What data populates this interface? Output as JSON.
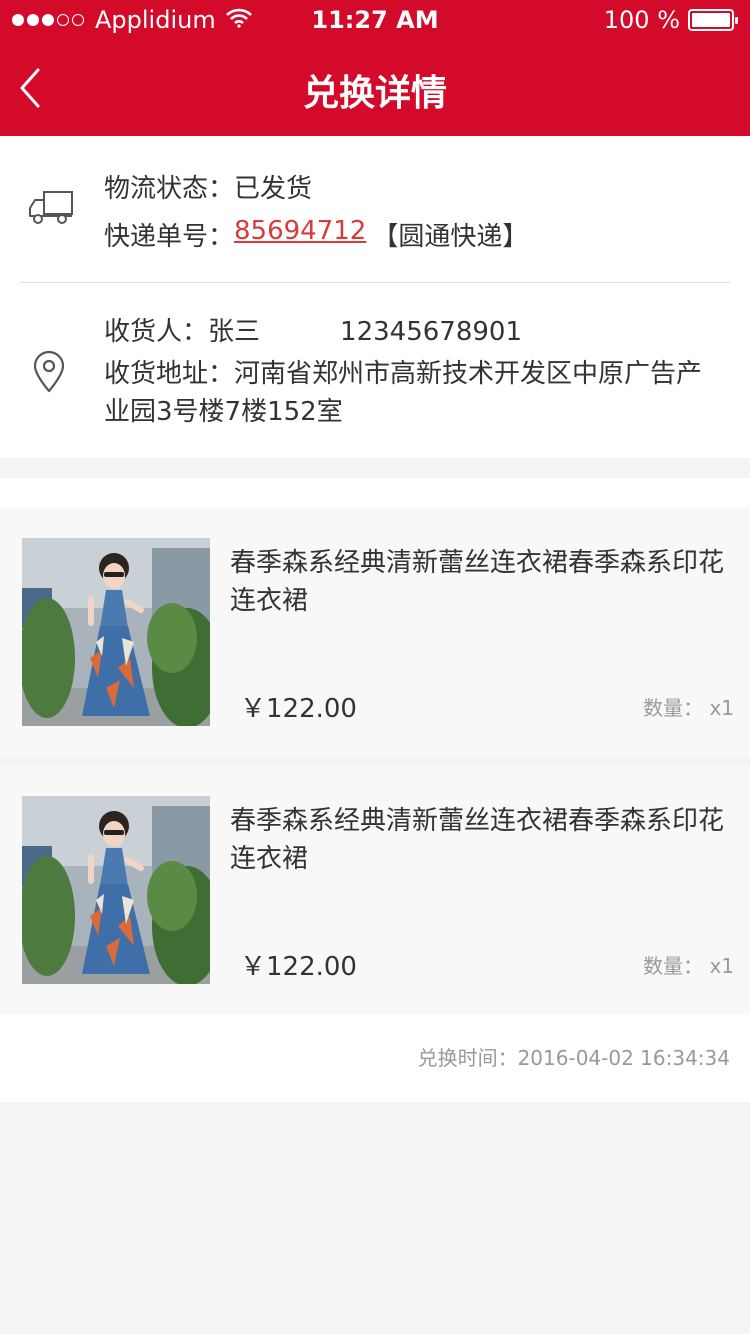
{
  "status_bar": {
    "carrier": "Applidium",
    "time": "11:27 AM",
    "battery": "100 %",
    "signal_bars_filled": 3,
    "signal_bars_total": 5
  },
  "nav": {
    "title": "兑换详情",
    "back_icon": "chevron-left-icon"
  },
  "logistics": {
    "status_label": "物流状态：",
    "status_value": "已发货",
    "tracking_label": "快递单号：",
    "tracking_number": "85694712",
    "carrier_name": "【圆通快递】",
    "icon": "truck-icon"
  },
  "address": {
    "receiver_label": "收货人：",
    "receiver_name": "张三",
    "phone": "12345678901",
    "address_label": "收货地址：",
    "address_value": "河南省郑州市高新技术开发区中原广告产业园3号楼7楼152室",
    "icon": "location-pin-icon"
  },
  "products": [
    {
      "name": "春季森系经典清新蕾丝连衣裙春季森系印花连衣裙",
      "price": "￥122.00",
      "qty_label": "数量：",
      "qty": "x1"
    },
    {
      "name": "春季森系经典清新蕾丝连衣裙春季森系印花连衣裙",
      "price": "￥122.00",
      "qty_label": "数量：",
      "qty": "x1"
    }
  ],
  "exchange_time": "兑换时间：2016-04-02 16:34:34",
  "colors": {
    "brand_red": "#d30a29",
    "link_red": "#d93a3a"
  }
}
